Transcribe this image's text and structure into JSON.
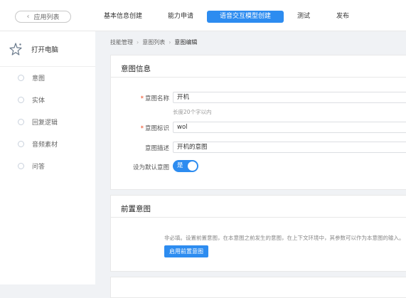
{
  "header": {
    "back_label": "应用列表",
    "tabs": [
      {
        "label": "基本信息创建",
        "active": false
      },
      {
        "label": "能力申请",
        "active": false
      },
      {
        "label": "语音交互模型创建",
        "active": true
      },
      {
        "label": "测试",
        "active": false
      },
      {
        "label": "发布",
        "active": false
      }
    ]
  },
  "sidebar": {
    "app_name": "打开电脑",
    "app_icon": "star-sparkle-icon",
    "items": [
      {
        "label": "意图"
      },
      {
        "label": "实体"
      },
      {
        "label": "回复逻辑"
      },
      {
        "label": "音频素材"
      },
      {
        "label": "问答"
      }
    ]
  },
  "breadcrumb": [
    "技能管理",
    "意图列表",
    "意图编辑"
  ],
  "intent_info": {
    "title": "意图信息",
    "name_label": "意图名称",
    "name_value": "开机",
    "name_hint": "长度20个字以内",
    "id_label": "意图标识",
    "id_value": "wol",
    "desc_label": "意图描述",
    "desc_value": "开机的意图",
    "default_label": "设为默认意图",
    "default_toggle_text": "是",
    "default_on": true
  },
  "pre_intent": {
    "title": "前置意图",
    "description": "非必填。设置前置意图，在本意图之前发生的意图，在上下文环境中，其参数可以作为本意图的输入。",
    "button_label": "启用前置意图"
  },
  "colors": {
    "accent": "#2d8cf0",
    "required": "#ed4014",
    "page_bg": "#f0f2f5"
  }
}
